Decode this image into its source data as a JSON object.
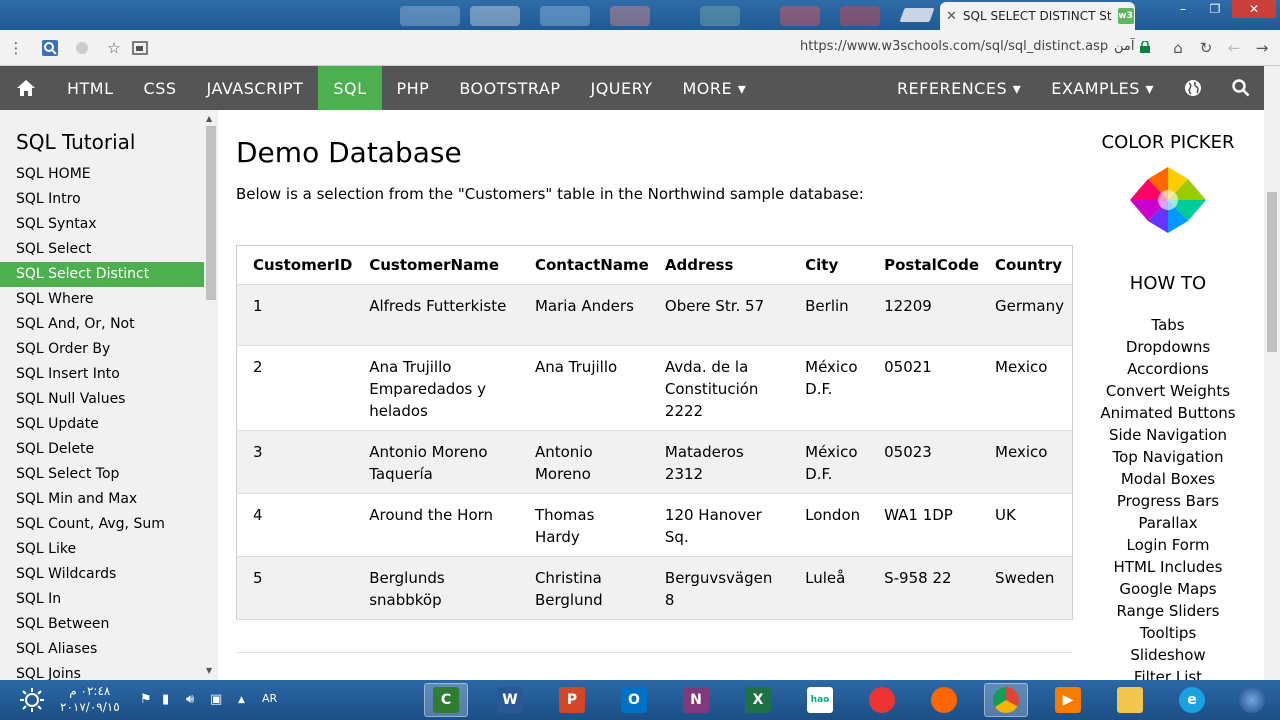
{
  "browser": {
    "tab_title": "SQL SELECT DISTINCT St",
    "tab_close": "✕",
    "tab_favicon": "w3",
    "url": "https://www.w3schools.com/sql/sql_distinct.asp",
    "secure_label": "آمن",
    "window_buttons": [
      "–",
      "❐",
      "✕"
    ]
  },
  "topnav": {
    "items": [
      "HTML",
      "CSS",
      "JAVASCRIPT",
      "SQL",
      "PHP",
      "BOOTSTRAP",
      "JQUERY",
      "MORE ▾"
    ],
    "right_items": [
      "REFERENCES ▾",
      "EXAMPLES ▾"
    ],
    "active": "SQL",
    "icons": [
      "home-icon",
      "globe-icon",
      "search-icon"
    ]
  },
  "sidebar": {
    "title": "SQL Tutorial",
    "items": [
      "SQL HOME",
      "SQL Intro",
      "SQL Syntax",
      "SQL Select",
      "SQL Select Distinct",
      "SQL Where",
      "SQL And, Or, Not",
      "SQL Order By",
      "SQL Insert Into",
      "SQL Null Values",
      "SQL Update",
      "SQL Delete",
      "SQL Select Top",
      "SQL Min and Max",
      "SQL Count, Avg, Sum",
      "SQL Like",
      "SQL Wildcards",
      "SQL In",
      "SQL Between",
      "SQL Aliases",
      "SQL Joins"
    ],
    "active_index": 4
  },
  "main": {
    "heading": "Demo Database",
    "intro": "Below is a selection from the \"Customers\" table in the Northwind sample database:",
    "table": {
      "headers": [
        "CustomerID",
        "CustomerName",
        "ContactName",
        "Address",
        "City",
        "PostalCode",
        "Country"
      ],
      "rows": [
        [
          "1",
          "Alfreds Futterkiste",
          "Maria Anders",
          "Obere Str. 57",
          "Berlin",
          "12209",
          "Germany"
        ],
        [
          "2",
          "Ana Trujillo Emparedados y helados",
          "Ana Trujillo",
          "Avda. de la Constitución 2222",
          "México D.F.",
          "05021",
          "Mexico"
        ],
        [
          "3",
          "Antonio Moreno Taquería",
          "Antonio Moreno",
          "Mataderos 2312",
          "México D.F.",
          "05023",
          "Mexico"
        ],
        [
          "4",
          "Around the Horn",
          "Thomas Hardy",
          "120 Hanover Sq.",
          "London",
          "WA1 1DP",
          "UK"
        ],
        [
          "5",
          "Berglunds snabbköp",
          "Christina Berglund",
          "Berguvsvägen 8",
          "Luleå",
          "S-958 22",
          "Sweden"
        ]
      ]
    }
  },
  "right": {
    "color_picker_title": "COLOR PICKER",
    "howto_title": "HOW TO",
    "links": [
      "Tabs",
      "Dropdowns",
      "Accordions",
      "Convert Weights",
      "Animated Buttons",
      "Side Navigation",
      "Top Navigation",
      "Modal Boxes",
      "Progress Bars",
      "Parallax",
      "Login Form",
      "HTML Includes",
      "Google Maps",
      "Range Sliders",
      "Tooltips",
      "Slideshow",
      "Filter List"
    ]
  },
  "taskbar": {
    "time": "٠٢:٤٨ م",
    "date": "٢٠١٧/٠٩/١٥",
    "lang": "AR",
    "apps": [
      "Camtasia",
      "W",
      "P",
      "O",
      "N",
      "X",
      "hao123",
      "Browser",
      "Firefox",
      "Chrome",
      "Media",
      "Explorer",
      "IE"
    ]
  },
  "colors": {
    "nav_bg": "#555555",
    "accent": "#4CAF50",
    "sidebar_bg": "#f1f1f1"
  }
}
